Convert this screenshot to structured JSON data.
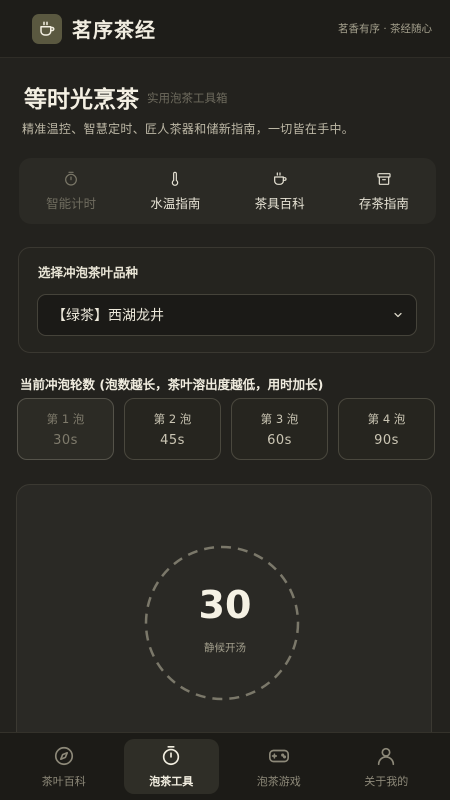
{
  "header": {
    "title": "茗序茶经",
    "motto": "茗香有序 · 茶经随心",
    "logo_icon": "tea-cup-icon"
  },
  "hero": {
    "title": "等时光烹茶",
    "subtitle": "实用泡茶工具箱",
    "description": "精准温控、智慧定时、匠人茶器和储新指南，一切皆在手中。"
  },
  "tools": [
    {
      "label": "智能计时",
      "icon": "stopwatch-icon",
      "active": true
    },
    {
      "label": "水温指南",
      "icon": "thermometer-icon",
      "active": false
    },
    {
      "label": "茶具百科",
      "icon": "tea-cup-icon",
      "active": false
    },
    {
      "label": "存茶指南",
      "icon": "archive-box-icon",
      "active": false
    }
  ],
  "variety": {
    "label": "选择冲泡茶叶品种",
    "selected": "【绿茶】西湖龙井"
  },
  "rounds": {
    "label": "当前冲泡轮数 (泡数越长，茶叶溶出度越低，用时加长)",
    "items": [
      {
        "name": "第 1 泡",
        "time": "30s",
        "active": true
      },
      {
        "name": "第 2 泡",
        "time": "45s",
        "active": false
      },
      {
        "name": "第 3 泡",
        "time": "60s",
        "active": false
      },
      {
        "name": "第 4 泡",
        "time": "90s",
        "active": false
      }
    ]
  },
  "timer": {
    "value": "30",
    "status": "静候开汤"
  },
  "nav": [
    {
      "label": "茶叶百科",
      "icon": "compass-icon",
      "active": false
    },
    {
      "label": "泡茶工具",
      "icon": "timer-icon",
      "active": true
    },
    {
      "label": "泡茶游戏",
      "icon": "gamepad-icon",
      "active": false
    },
    {
      "label": "关于我的",
      "icon": "user-icon",
      "active": false
    }
  ],
  "colors": {
    "background": "#23221e",
    "card": "#2a2925",
    "accent": "#5a5840",
    "text": "#e9e5d6",
    "muted": "#6f6c5f"
  }
}
